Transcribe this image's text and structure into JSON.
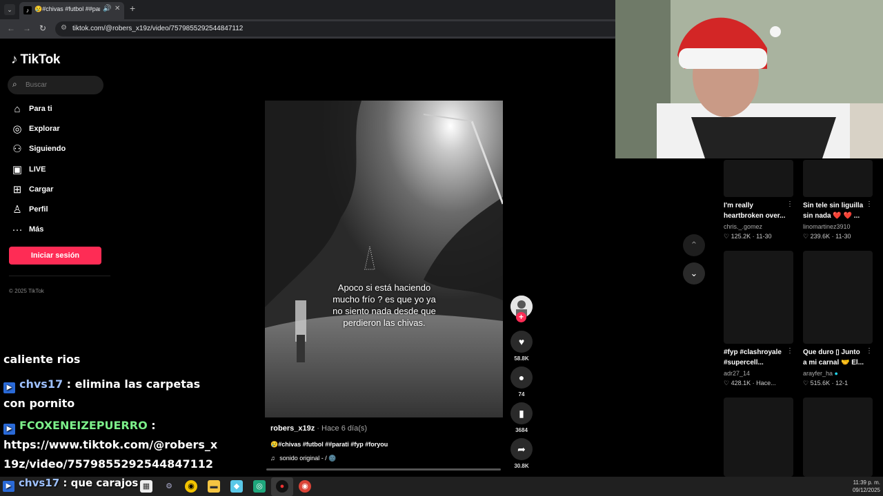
{
  "browser": {
    "tab_title": "😢#chivas #futbol ##parati",
    "url": "tiktok.com/@robers_x19z/video/7579855292544847112"
  },
  "sidebar": {
    "brand": "TikTok",
    "search_placeholder": "Buscar",
    "items": [
      {
        "label": "Para ti",
        "icon": "home-icon"
      },
      {
        "label": "Explorar",
        "icon": "compass-icon"
      },
      {
        "label": "Siguiendo",
        "icon": "following-icon"
      },
      {
        "label": "LIVE",
        "icon": "live-icon"
      },
      {
        "label": "Cargar",
        "icon": "upload-icon"
      },
      {
        "label": "Perfil",
        "icon": "profile-icon"
      },
      {
        "label": "Más",
        "icon": "more-icon"
      }
    ],
    "login_label": "Iniciar sesión",
    "copyright": "© 2025 TikTok"
  },
  "chat": {
    "partial_line": "caliente rios",
    "messages": [
      {
        "user": "chvs17",
        "separator": " : ",
        "text": "elimina las carpetas",
        "cont": "con pornito"
      },
      {
        "user": "FCOXENEIZEPUERRO",
        "separator": " :",
        "text": "https://www.tiktok.com/@robers_x",
        "cont": "19z/video/7579855292544847112"
      },
      {
        "user": "chvs17",
        "separator": " : ",
        "text": "que carajos"
      }
    ]
  },
  "video": {
    "overlay_text": "Apoco si está haciendo mucho frío ? es que yo ya no siento nada desde que perdieron las chivas.",
    "author": "robers_x19z",
    "time_ago": " · Hace 6 día(s)",
    "tags": "😢#chivas #futbol ##parati #fyp #foryou",
    "sound": "sonido original - / 🌚",
    "likes": "58.8K",
    "comments": "74",
    "saves": "3684",
    "shares": "30.8K"
  },
  "related": [
    {
      "title_1": "I'm really",
      "title_2": "heartbroken over...",
      "author": "chris._.gomez",
      "likes": "125.2K",
      "date": "11-30"
    },
    {
      "title_1": "Sin tele sin liguilla",
      "title_2": "sin nada ❤️ ❤️ ...",
      "author": "linomartinez3910",
      "likes": "239.6K",
      "date": "11-30"
    },
    {
      "title_1": "#fyp #clashroyale",
      "title_2": "#supercell...",
      "author": "adr27_14",
      "likes": "428.1K",
      "date": "Hace..."
    },
    {
      "title_1": "Que duro ▯ Junto",
      "title_2": "a mi carnal 🤝 El...",
      "author": "arayfer_ha",
      "likes": "515.6K",
      "date": "12-1"
    }
  ],
  "taskbar": {
    "time": "11:39 p. m.",
    "date": "09/12/2025"
  },
  "colors": {
    "brand_pink": "#fe2c55",
    "background": "#000000"
  }
}
